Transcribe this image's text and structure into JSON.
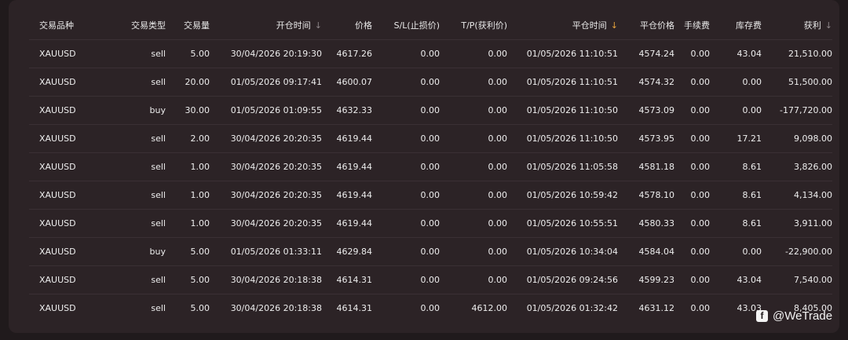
{
  "table": {
    "headers": {
      "symbol": "交易品种",
      "type": "交易类型",
      "volume": "交易量",
      "open_time": "开仓时间",
      "price": "价格",
      "sl": "S/L(止损价)",
      "tp": "T/P(获利价)",
      "close_time": "平仓时间",
      "close_price": "平仓价格",
      "commission": "手续费",
      "swap": "库存费",
      "profit": "获利"
    },
    "sort_icon": "↓",
    "rows": [
      {
        "symbol": "XAUUSD",
        "type": "sell",
        "volume": "5.00",
        "open_time": "30/04/2026 20:19:30",
        "price": "4617.26",
        "sl": "0.00",
        "tp": "0.00",
        "close_time": "01/05/2026 11:10:51",
        "close_price": "4574.24",
        "commission": "0.00",
        "swap": "43.04",
        "profit": "21,510.00"
      },
      {
        "symbol": "XAUUSD",
        "type": "sell",
        "volume": "20.00",
        "open_time": "01/05/2026 09:17:41",
        "price": "4600.07",
        "sl": "0.00",
        "tp": "0.00",
        "close_time": "01/05/2026 11:10:51",
        "close_price": "4574.32",
        "commission": "0.00",
        "swap": "0.00",
        "profit": "51,500.00"
      },
      {
        "symbol": "XAUUSD",
        "type": "buy",
        "volume": "30.00",
        "open_time": "01/05/2026 01:09:55",
        "price": "4632.33",
        "sl": "0.00",
        "tp": "0.00",
        "close_time": "01/05/2026 11:10:50",
        "close_price": "4573.09",
        "commission": "0.00",
        "swap": "0.00",
        "profit": "-177,720.00"
      },
      {
        "symbol": "XAUUSD",
        "type": "sell",
        "volume": "2.00",
        "open_time": "30/04/2026 20:20:35",
        "price": "4619.44",
        "sl": "0.00",
        "tp": "0.00",
        "close_time": "01/05/2026 11:10:50",
        "close_price": "4573.95",
        "commission": "0.00",
        "swap": "17.21",
        "profit": "9,098.00"
      },
      {
        "symbol": "XAUUSD",
        "type": "sell",
        "volume": "1.00",
        "open_time": "30/04/2026 20:20:35",
        "price": "4619.44",
        "sl": "0.00",
        "tp": "0.00",
        "close_time": "01/05/2026 11:05:58",
        "close_price": "4581.18",
        "commission": "0.00",
        "swap": "8.61",
        "profit": "3,826.00"
      },
      {
        "symbol": "XAUUSD",
        "type": "sell",
        "volume": "1.00",
        "open_time": "30/04/2026 20:20:35",
        "price": "4619.44",
        "sl": "0.00",
        "tp": "0.00",
        "close_time": "01/05/2026 10:59:42",
        "close_price": "4578.10",
        "commission": "0.00",
        "swap": "8.61",
        "profit": "4,134.00"
      },
      {
        "symbol": "XAUUSD",
        "type": "sell",
        "volume": "1.00",
        "open_time": "30/04/2026 20:20:35",
        "price": "4619.44",
        "sl": "0.00",
        "tp": "0.00",
        "close_time": "01/05/2026 10:55:51",
        "close_price": "4580.33",
        "commission": "0.00",
        "swap": "8.61",
        "profit": "3,911.00"
      },
      {
        "symbol": "XAUUSD",
        "type": "buy",
        "volume": "5.00",
        "open_time": "01/05/2026 01:33:11",
        "price": "4629.84",
        "sl": "0.00",
        "tp": "0.00",
        "close_time": "01/05/2026 10:34:04",
        "close_price": "4584.04",
        "commission": "0.00",
        "swap": "0.00",
        "profit": "-22,900.00"
      },
      {
        "symbol": "XAUUSD",
        "type": "sell",
        "volume": "5.00",
        "open_time": "30/04/2026 20:18:38",
        "price": "4614.31",
        "sl": "0.00",
        "tp": "0.00",
        "close_time": "01/05/2026 09:24:56",
        "close_price": "4599.23",
        "commission": "0.00",
        "swap": "43.04",
        "profit": "7,540.00"
      },
      {
        "symbol": "XAUUSD",
        "type": "sell",
        "volume": "5.00",
        "open_time": "30/04/2026 20:18:38",
        "price": "4614.31",
        "sl": "0.00",
        "tp": "4612.00",
        "close_time": "01/05/2026 01:32:42",
        "close_price": "4631.12",
        "commission": "0.00",
        "swap": "43.03",
        "profit": "8,405.00"
      }
    ]
  },
  "watermark": {
    "logo_glyph": "f",
    "text": "@WeTrade"
  },
  "colors": {
    "background": "#201a1c",
    "panel": "#2c2326",
    "active_sort": "#e6a23c",
    "inactive_sort": "#8c8488"
  }
}
